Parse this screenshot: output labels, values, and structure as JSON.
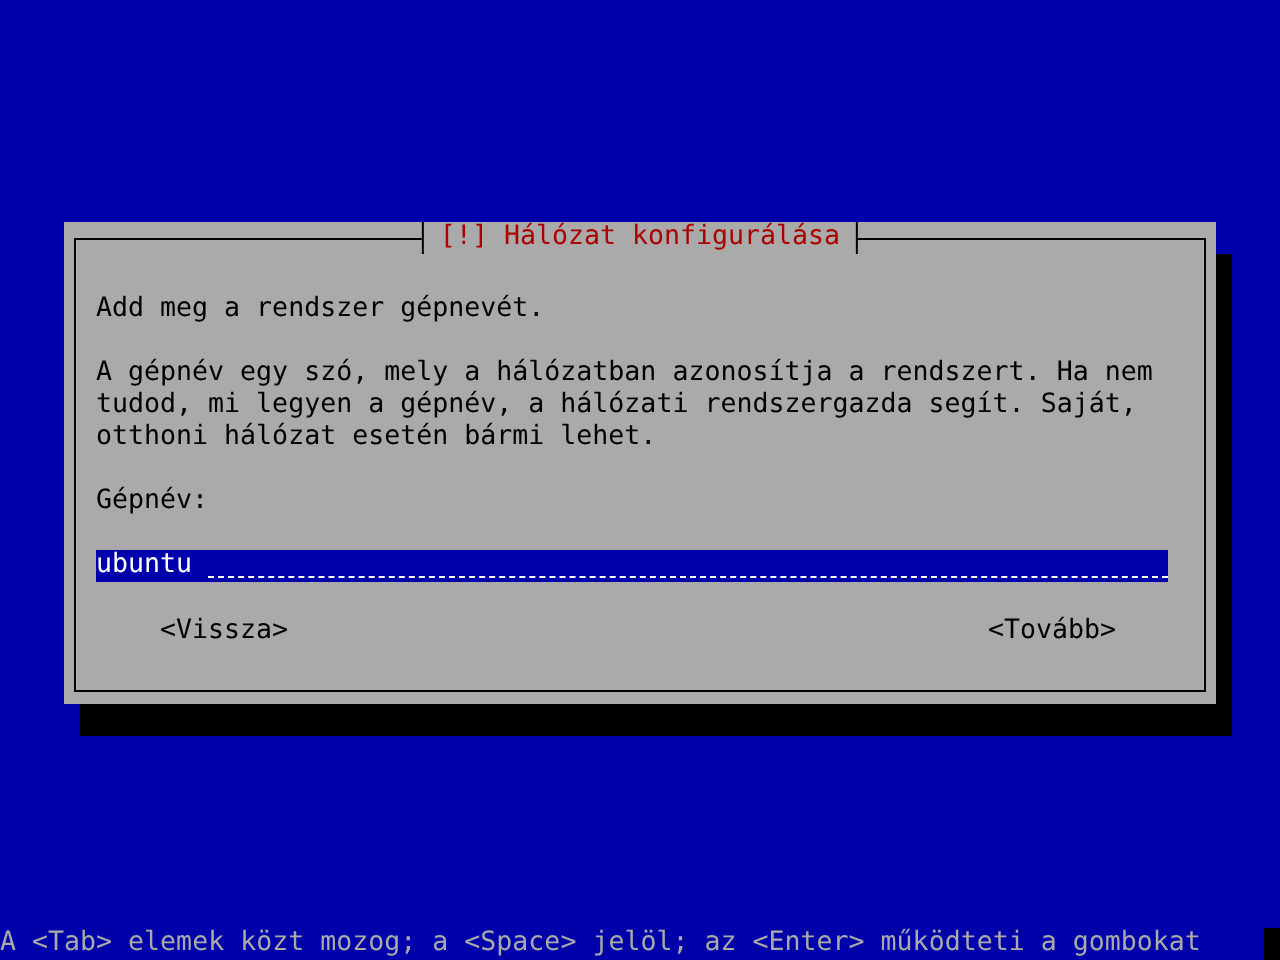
{
  "dialog": {
    "title": "[!] Hálózat konfigurálása",
    "prompt": "Add meg a rendszer gépnevét.",
    "description": "A gépnév egy szó, mely a hálózatban azonosítja a rendszert. Ha nem tudod, mi legyen a gépnév, a hálózati rendszergazda segít. Saját, otthoni hálózat esetén bármi lehet.",
    "field": {
      "label": "Gépnév:",
      "value": "ubuntu"
    },
    "buttons": [
      {
        "label": "<Vissza>",
        "selected": false
      },
      {
        "label": "<Tovább>",
        "selected": false
      }
    ]
  },
  "status_bar": "A <Tab> elemek közt mozog; a <Space> jelöl; az <Enter> működteti a gombokat"
}
